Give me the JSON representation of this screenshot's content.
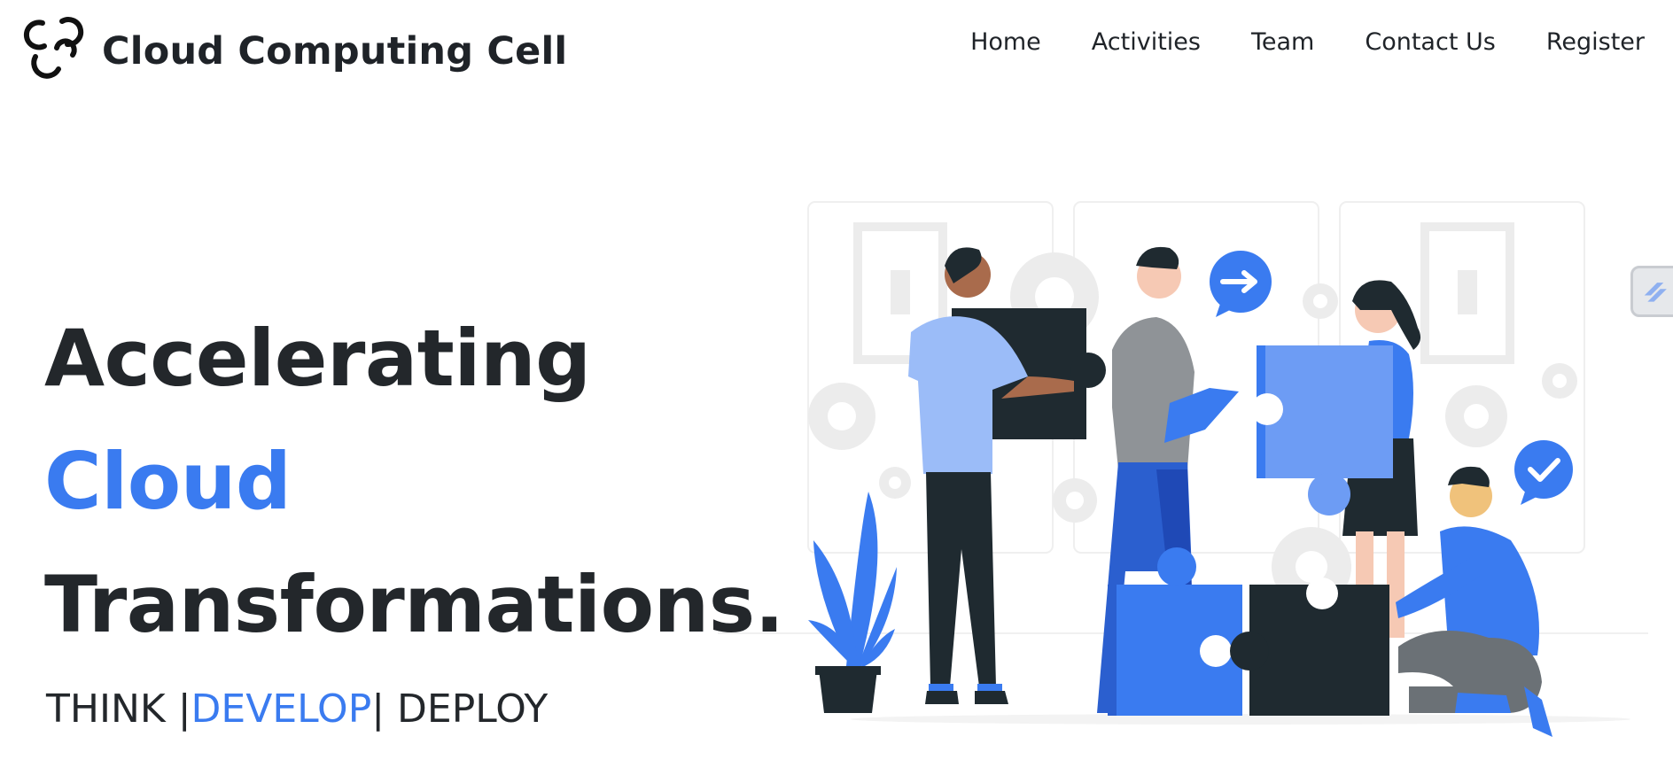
{
  "brand": {
    "name": "Cloud Computing Cell",
    "logo_icon": "cloud-logo-icon"
  },
  "nav": {
    "items": [
      {
        "label": "Home"
      },
      {
        "label": "Activities"
      },
      {
        "label": "Team"
      },
      {
        "label": "Contact Us"
      },
      {
        "label": "Register"
      }
    ]
  },
  "hero": {
    "line1": "Accelerating",
    "line2": "Cloud",
    "line3": "Transformations.",
    "tagline": {
      "part1": "THINK |",
      "part2": "DEVELOP",
      "part3": "| DEPLOY"
    }
  },
  "colors": {
    "accent": "#3a7bf0",
    "dark": "#23272b",
    "light_blue": "#9bbcf8",
    "puzzle_dark": "#1f2a30"
  },
  "illustration": {
    "subject": "team-assembling-puzzle-illustration"
  },
  "widget": {
    "icon": "slider-toggle-icon"
  }
}
